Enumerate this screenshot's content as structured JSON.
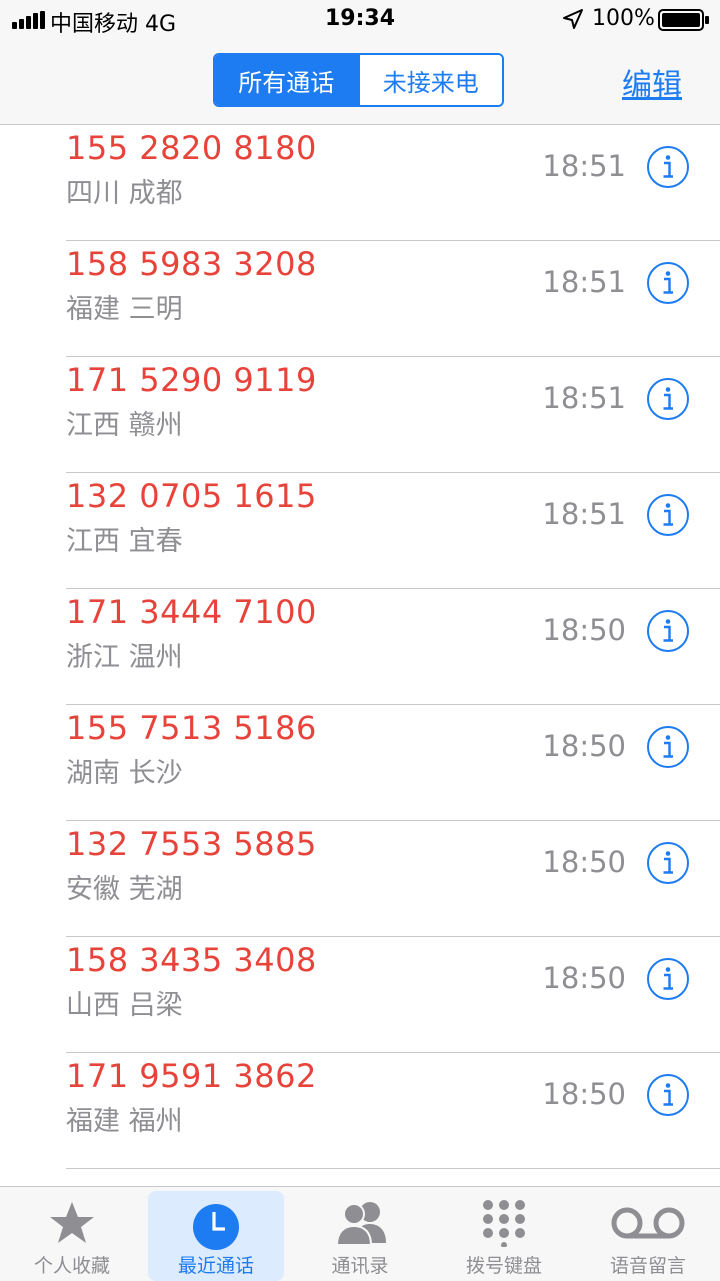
{
  "status": {
    "carrier": "中国移动  4G",
    "time": "19:34",
    "battery": "100%"
  },
  "nav": {
    "segments": [
      "所有通话",
      "未接来电"
    ],
    "edit": "编辑"
  },
  "calls": [
    {
      "number": "155 2820 8180",
      "location": "四川 成都",
      "time": "18:51"
    },
    {
      "number": "158 5983 3208",
      "location": "福建 三明",
      "time": "18:51"
    },
    {
      "number": "171 5290 9119",
      "location": "江西 赣州",
      "time": "18:51"
    },
    {
      "number": "132 0705 1615",
      "location": "江西 宜春",
      "time": "18:51"
    },
    {
      "number": "171 3444 7100",
      "location": "浙江 温州",
      "time": "18:50"
    },
    {
      "number": "155 7513 5186",
      "location": "湖南 长沙",
      "time": "18:50"
    },
    {
      "number": "132 7553 5885",
      "location": "安徽 芜湖",
      "time": "18:50"
    },
    {
      "number": "158 3435 3408",
      "location": "山西 吕梁",
      "time": "18:50"
    },
    {
      "number": "171 9591 3862",
      "location": "福建 福州",
      "time": "18:50"
    }
  ],
  "tabs": [
    {
      "label": "个人收藏",
      "icon": "star-icon"
    },
    {
      "label": "最近通话",
      "icon": "clock-icon"
    },
    {
      "label": "通讯录",
      "icon": "contacts-icon"
    },
    {
      "label": "拨号键盘",
      "icon": "keypad-icon"
    },
    {
      "label": "语音留言",
      "icon": "voicemail-icon"
    }
  ],
  "colors": {
    "accent": "#1d7cf2",
    "missed": "#e8433a",
    "secondary": "#8e8e93"
  }
}
